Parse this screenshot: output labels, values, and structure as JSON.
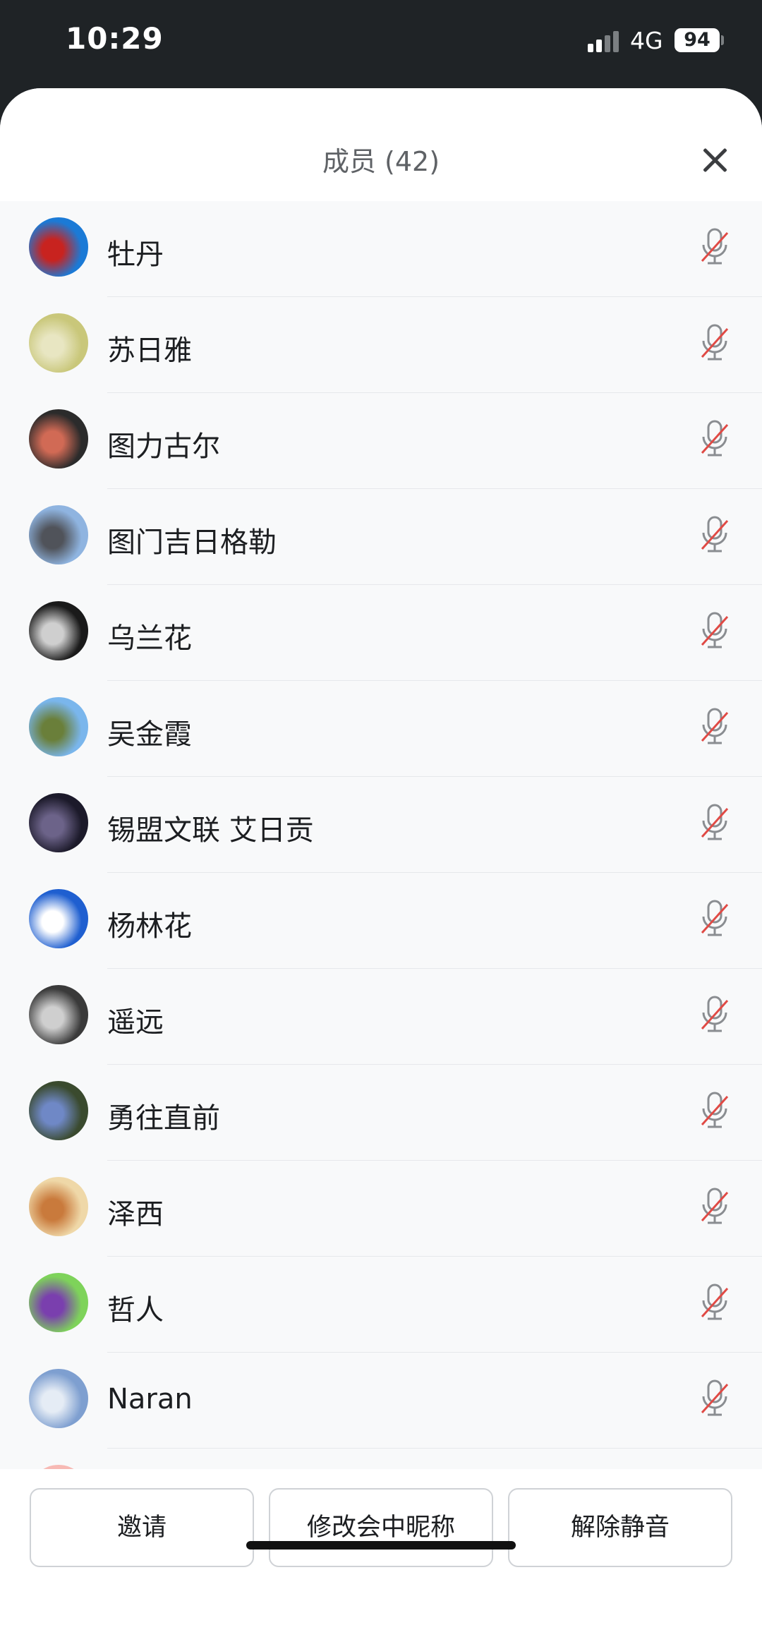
{
  "status_bar": {
    "time": "10:29",
    "network": "4G",
    "battery": "94"
  },
  "sheet": {
    "title": "成员 (42)"
  },
  "members": [
    {
      "name": "牡丹",
      "avatar_colors": [
        "#1b7ad6",
        "#c8231f"
      ]
    },
    {
      "name": "苏日雅",
      "avatar_colors": [
        "#c9c77a",
        "#e8e6c2"
      ]
    },
    {
      "name": "图力古尔",
      "avatar_colors": [
        "#2b2b2b",
        "#d16a55"
      ]
    },
    {
      "name": "图门吉日格勒",
      "avatar_colors": [
        "#8fb4e0",
        "#50535a"
      ]
    },
    {
      "name": "乌兰花",
      "avatar_colors": [
        "#1a1a1a",
        "#cfcfcf"
      ]
    },
    {
      "name": "吴金霞",
      "avatar_colors": [
        "#7ab6ec",
        "#6a7f3a"
      ]
    },
    {
      "name": "锡盟文联 艾日贡",
      "avatar_colors": [
        "#1c1a2a",
        "#6c6389"
      ]
    },
    {
      "name": "杨林花",
      "avatar_colors": [
        "#1f5fd0",
        "#ffffff"
      ]
    },
    {
      "name": "遥远",
      "avatar_colors": [
        "#3a3a3a",
        "#cfcfcf"
      ]
    },
    {
      "name": "勇往直前",
      "avatar_colors": [
        "#3a4a2e",
        "#6f88c6"
      ]
    },
    {
      "name": "泽西",
      "avatar_colors": [
        "#efd8a8",
        "#c97a3c"
      ]
    },
    {
      "name": "哲人",
      "avatar_colors": [
        "#7ed35a",
        "#7a3fae"
      ]
    },
    {
      "name": "Naran",
      "avatar_colors": [
        "#7e9fd0",
        "#e5ecf5"
      ]
    },
    {
      "name": "",
      "avatar_colors": [
        "#f7b9b4",
        "#f3d0cc"
      ]
    }
  ],
  "actions": {
    "invite": "邀请",
    "rename": "修改会中昵称",
    "unmute": "解除静音"
  },
  "icons": {
    "mic": "mic-muted-icon",
    "close": "close-icon"
  },
  "colors": {
    "mute_slash": "#e04a45",
    "mic_gray": "#8a8d91"
  }
}
